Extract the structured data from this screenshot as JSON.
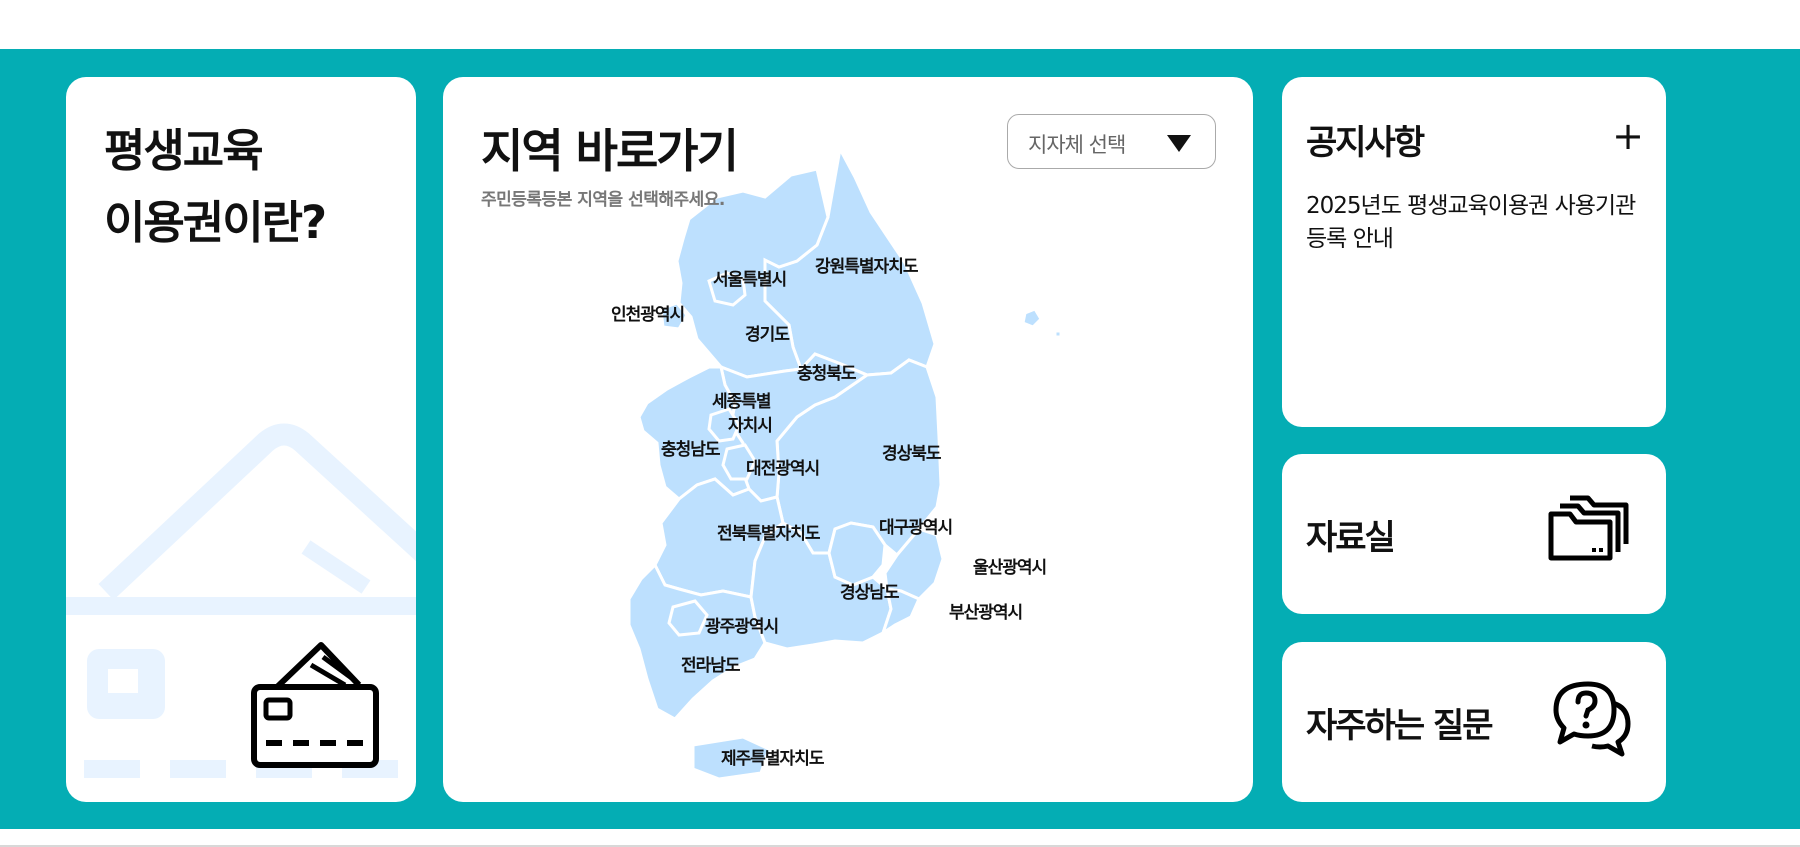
{
  "intro": {
    "title_line1": "평생교육",
    "title_line2": "이용권이란?",
    "icon": "card-icon"
  },
  "region_map": {
    "title": "지역 바로가기",
    "subtitle": "주민등록등본 지역을 선택해주세요.",
    "select_label": "지자체 선택",
    "regions": {
      "seoul": "서울특별시",
      "gangwon": "강원특별자치도",
      "incheon": "인천광역시",
      "gyeonggi": "경기도",
      "chungbuk": "충청북도",
      "sejong_line1": "세종특별",
      "sejong_line2": "자치시",
      "chungnam": "충청남도",
      "daejeon": "대전광역시",
      "gyeongbuk": "경상북도",
      "daegu": "대구광역시",
      "jeonbuk": "전북특별자치도",
      "ulsan": "울산광역시",
      "gyeongnam": "경상남도",
      "busan": "부산광역시",
      "gwangju": "광주광역시",
      "jeonnam": "전라남도",
      "jeju": "제주특별자치도"
    },
    "colors": {
      "land": "#bde0fe",
      "background": "#04adb4"
    }
  },
  "notice": {
    "title": "공지사항",
    "more": "+",
    "items": [
      "2025년도 평생교육이용권 사용기관 등록 안내"
    ]
  },
  "archive": {
    "title": "자료실",
    "icon": "folder-icon"
  },
  "faq": {
    "title": "자주하는 질문",
    "icon": "question-chat-icon"
  }
}
